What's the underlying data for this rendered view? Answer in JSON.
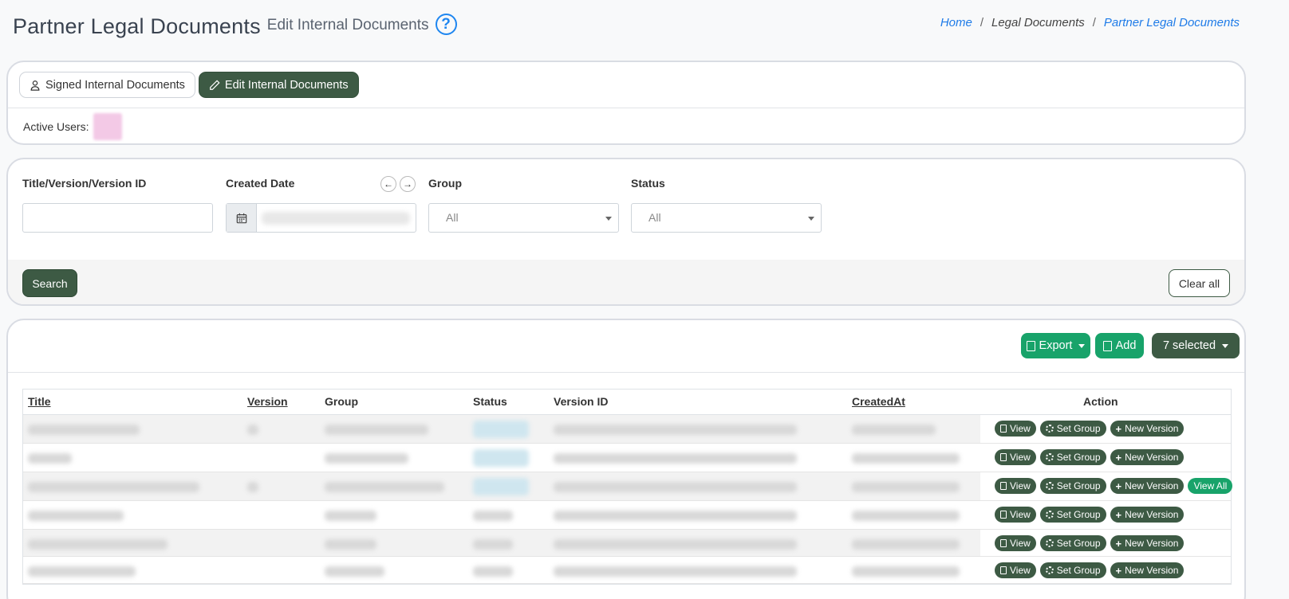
{
  "header": {
    "title": "Partner Legal Documents",
    "subtitle": "Edit Internal Documents",
    "help_icon": "?"
  },
  "breadcrumb": {
    "home": "Home",
    "sep": "/",
    "legal": "Legal Documents",
    "current": "Partner Legal Documents"
  },
  "tabs": {
    "signed": "Signed Internal Documents",
    "edit": "Edit Internal Documents"
  },
  "active_users_label": "Active Users:",
  "filters": {
    "title_label": "Title/Version/Version ID",
    "title_value": "",
    "created_label": "Created Date",
    "prev_arrow": "←",
    "next_arrow": "→",
    "group_label": "Group",
    "group_value": "All",
    "status_label": "Status",
    "status_value": "All",
    "search_btn": "Search",
    "clear_btn": "Clear all"
  },
  "toolbar": {
    "export": "Export",
    "add": "Add",
    "selected": "7 selected"
  },
  "table": {
    "headers": {
      "title": "Title",
      "version": "Version",
      "group": "Group",
      "status": "Status",
      "version_id": "Version ID",
      "created_at": "CreatedAt",
      "action": "Action"
    },
    "actions": {
      "view": "View",
      "set_group": "Set Group",
      "new_version": "New Version",
      "view_all": "View All"
    }
  },
  "colors": {
    "primary_dark_green": "#3d5a44",
    "accent_green": "#18a36a",
    "link_blue": "#1e7be8"
  }
}
